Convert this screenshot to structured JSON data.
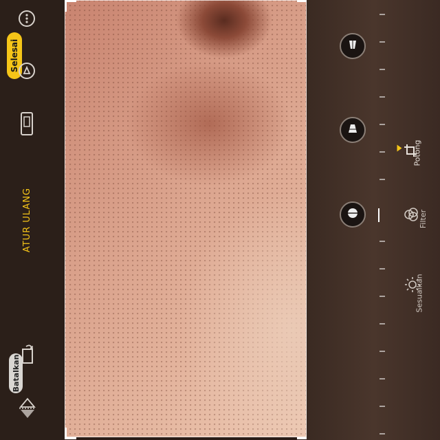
{
  "toolbar": {
    "done_label": "Selesai",
    "cancel_label": "Batalkan",
    "reset_label": "ATUR ULANG"
  },
  "tabs": [
    {
      "label": "Potong",
      "active": true
    },
    {
      "label": "Filter",
      "active": false
    },
    {
      "label": "Sesuaikan",
      "active": false
    }
  ],
  "colors": {
    "accent": "#f5c518",
    "panel": "#2b1f19",
    "cancel_bg": "#d9d6d2"
  },
  "icons": [
    "more-icon",
    "markup-icon",
    "aspect-ratio-icon",
    "rotate-icon",
    "flip-icon",
    "perspective-vertical-icon",
    "perspective-horizontal-icon",
    "straighten-icon",
    "crop-icon",
    "filter-icon",
    "adjust-icon"
  ]
}
